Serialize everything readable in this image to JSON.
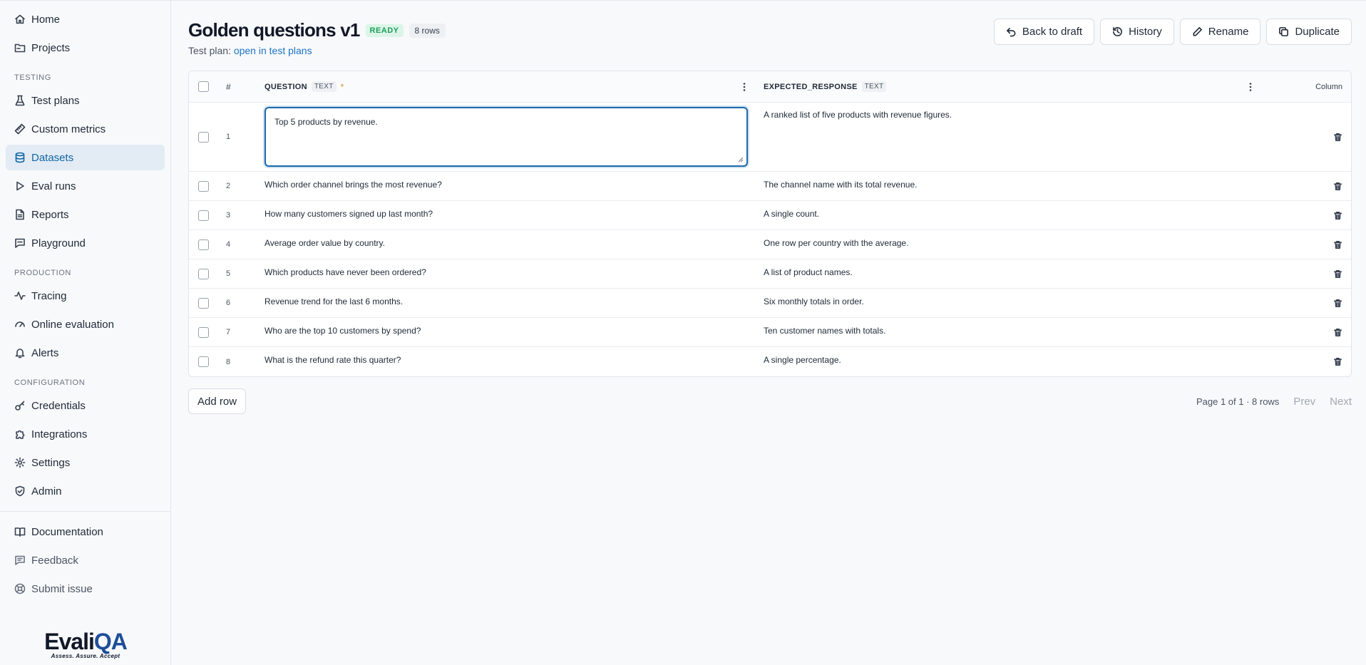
{
  "sidebar": {
    "top_items": [
      {
        "label": "Home",
        "icon": "home-icon"
      },
      {
        "label": "Projects",
        "icon": "folder-icon"
      }
    ],
    "sections": [
      {
        "label": "TESTING",
        "items": [
          {
            "label": "Test plans",
            "icon": "flask-icon"
          },
          {
            "label": "Custom metrics",
            "icon": "ruler-icon"
          },
          {
            "label": "Datasets",
            "icon": "database-icon",
            "active": true
          },
          {
            "label": "Eval runs",
            "icon": "play-icon"
          },
          {
            "label": "Reports",
            "icon": "file-text-icon"
          },
          {
            "label": "Playground",
            "icon": "message-icon"
          }
        ]
      },
      {
        "label": "PRODUCTION",
        "items": [
          {
            "label": "Tracing",
            "icon": "activity-icon"
          },
          {
            "label": "Online evaluation",
            "icon": "gauge-icon"
          },
          {
            "label": "Alerts",
            "icon": "bell-icon"
          }
        ]
      },
      {
        "label": "CONFIGURATION",
        "items": [
          {
            "label": "Credentials",
            "icon": "key-icon"
          },
          {
            "label": "Integrations",
            "icon": "puzzle-icon"
          },
          {
            "label": "Settings",
            "icon": "gear-icon"
          },
          {
            "label": "Admin",
            "icon": "shield-icon"
          }
        ]
      }
    ],
    "bottom_items": [
      {
        "label": "Documentation",
        "icon": "book-icon"
      },
      {
        "label": "Feedback",
        "icon": "message-square-icon"
      },
      {
        "label": "Submit issue",
        "icon": "lifebuoy-icon"
      }
    ],
    "logo": {
      "word_main": "Evali",
      "word_accent": "QA",
      "tagline": "Assess. Assure. Accept"
    }
  },
  "header": {
    "title": "Golden questions v1",
    "status": "READY",
    "row_count": "8 rows",
    "subtitle_prefix": "Test plan:",
    "subtitle_link": "open in test plans",
    "buttons": {
      "back": "Back to draft",
      "history": "History",
      "rename": "Rename",
      "duplicate": "Duplicate"
    }
  },
  "table": {
    "num_header": "#",
    "columns": [
      {
        "name": "QUESTION",
        "type": "TEXT",
        "required": "*"
      },
      {
        "name": "EXPECTED_RESPONSE",
        "type": "TEXT"
      }
    ],
    "add_column_label": "Column",
    "editing_row": {
      "num": "1",
      "question": "Top 5 products by revenue.",
      "expected": "A ranked list of five products with revenue figures."
    },
    "rows": [
      {
        "num": "2",
        "question": "Which order channel brings the most revenue?",
        "expected": "The channel name with its total revenue."
      },
      {
        "num": "3",
        "question": "How many customers signed up last month?",
        "expected": "A single count."
      },
      {
        "num": "4",
        "question": "Average order value by country.",
        "expected": "One row per country with the average."
      },
      {
        "num": "5",
        "question": "Which products have never been ordered?",
        "expected": "A list of product names."
      },
      {
        "num": "6",
        "question": "Revenue trend for the last 6 months.",
        "expected": "Six monthly totals in order."
      },
      {
        "num": "7",
        "question": "Who are the top 10 customers by spend?",
        "expected": "Ten customer names with totals."
      },
      {
        "num": "8",
        "question": "What is the refund rate this quarter?",
        "expected": "A single percentage."
      }
    ]
  },
  "footer": {
    "add_row": "Add row",
    "page_info": "Page 1 of 1 · 8 rows",
    "prev": "Prev",
    "next": "Next"
  }
}
